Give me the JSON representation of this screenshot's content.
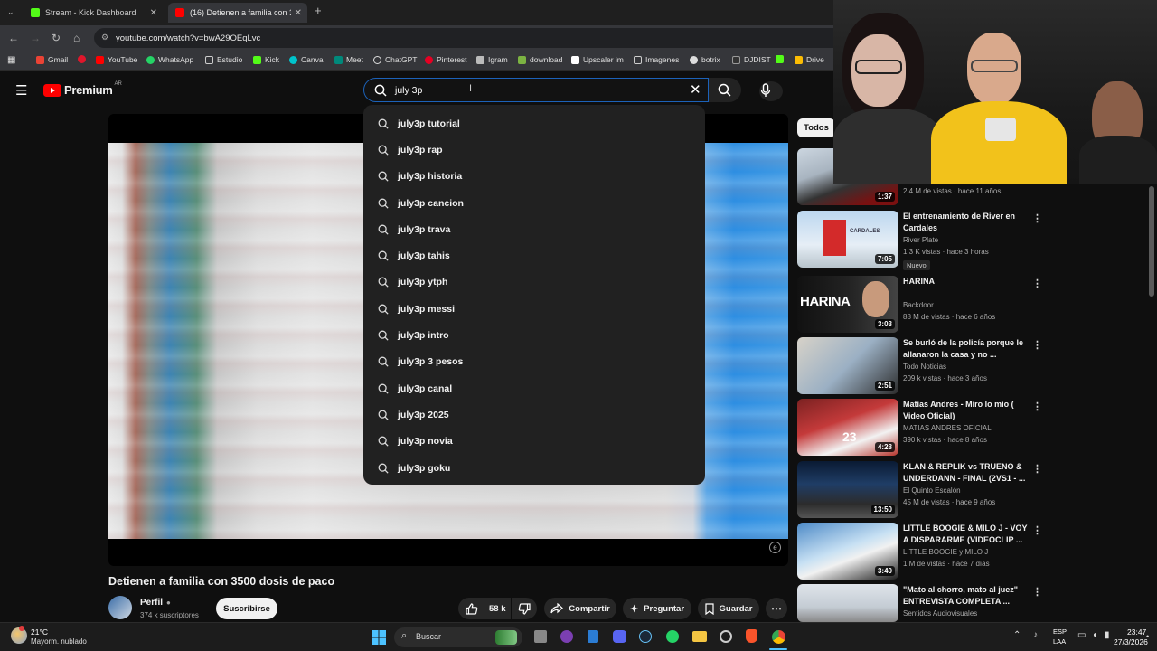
{
  "browser": {
    "tabs": [
      {
        "label": "Stream - Kick Dashboard",
        "color": "#53fc18"
      },
      {
        "label": "(16) Detienen a familia con 3500",
        "color": "#ff0000"
      }
    ],
    "url": "youtube.com/watch?v=bwA29OEqLvc",
    "bookmarks": [
      "Gmail",
      "YouTube",
      "WhatsApp",
      "Estudio",
      "Kick",
      "Canva",
      "Meet",
      "ChatGPT",
      "Pinterest",
      "Igram",
      "download",
      "Upscaler im",
      "Imagenes",
      "botrix",
      "DJDIST",
      "Drive"
    ]
  },
  "youtube": {
    "logo_text": "Premium",
    "region": "AR",
    "search": {
      "query": "july 3p",
      "suggestions": [
        "july3p tutorial",
        "july3p rap",
        "july3p historia",
        "july3p cancion",
        "july3p trava",
        "july3p tahis",
        "july3p ytph",
        "july3p messi",
        "july3p intro",
        "july3p 3 pesos",
        "july3p canal",
        "july3p 2025",
        "july3p novia",
        "july3p goku"
      ]
    },
    "video": {
      "title": "Detienen a familia con 3500 dosis de paco",
      "channel": "Perfil",
      "subscribers": "374 k suscriptores",
      "subscribe_label": "Suscribirse",
      "likes": "58 k",
      "share_label": "Compartir",
      "ask_label": "Preguntar",
      "save_label": "Guardar"
    },
    "filter_chip": "Todos",
    "recommendations": [
      {
        "title": "",
        "channel": "",
        "meta": "2.4 M de vistas · hace 11 años",
        "duration": "1:37",
        "badge": ""
      },
      {
        "title": "El entrenamiento de River en Cardales",
        "channel": "River Plate",
        "meta": "1.3 K vistas · hace 3 horas",
        "duration": "7:05",
        "badge": "Nuevo"
      },
      {
        "title": "HARINA",
        "channel": "Backdoor",
        "meta": "88 M de vistas · hace 6 años",
        "duration": "3:03",
        "badge": ""
      },
      {
        "title": "Se burló de la policía porque le allanaron la casa y no ...",
        "channel": "Todo Noticias",
        "meta": "209 k vistas · hace 3 años",
        "duration": "2:51",
        "badge": ""
      },
      {
        "title": "Matias Andres - Miro lo mio ( Video Oficial)",
        "channel": "MATIAS ANDRES OFICIAL",
        "meta": "390 k vistas · hace 8 años",
        "duration": "4:28",
        "badge": ""
      },
      {
        "title": "KLAN & REPLIK vs TRUENO & UNDERDANN - FINAL (2VS1 - ...",
        "channel": "El Quinto Escalón",
        "meta": "45 M de vistas · hace 9 años",
        "duration": "13:50",
        "badge": ""
      },
      {
        "title": "LITTLE BOOGIE & MILO J - VOY A DISPARARME (VIDEOCLIP ...",
        "channel": "LITTLE BOOGIE y MILO J",
        "meta": "1 M de vistas · hace 7 días",
        "duration": "3:40",
        "badge": ""
      },
      {
        "title": "\"Mato al chorro, mato al juez\" ENTREVISTA COMPLETA ...",
        "channel": "Sentidos Audiovisuales",
        "meta": "",
        "duration": "",
        "badge": ""
      }
    ],
    "thumbnail_text": {
      "cardales": "CARDALES",
      "harina": "HARINA"
    }
  },
  "taskbar": {
    "weather_temp": "21°C",
    "weather_desc": "Mayorm. nublado",
    "search_label": "Buscar",
    "lang1": "ESP",
    "lang2": "LAA",
    "time": "23:47",
    "date": "27/3/2026"
  }
}
